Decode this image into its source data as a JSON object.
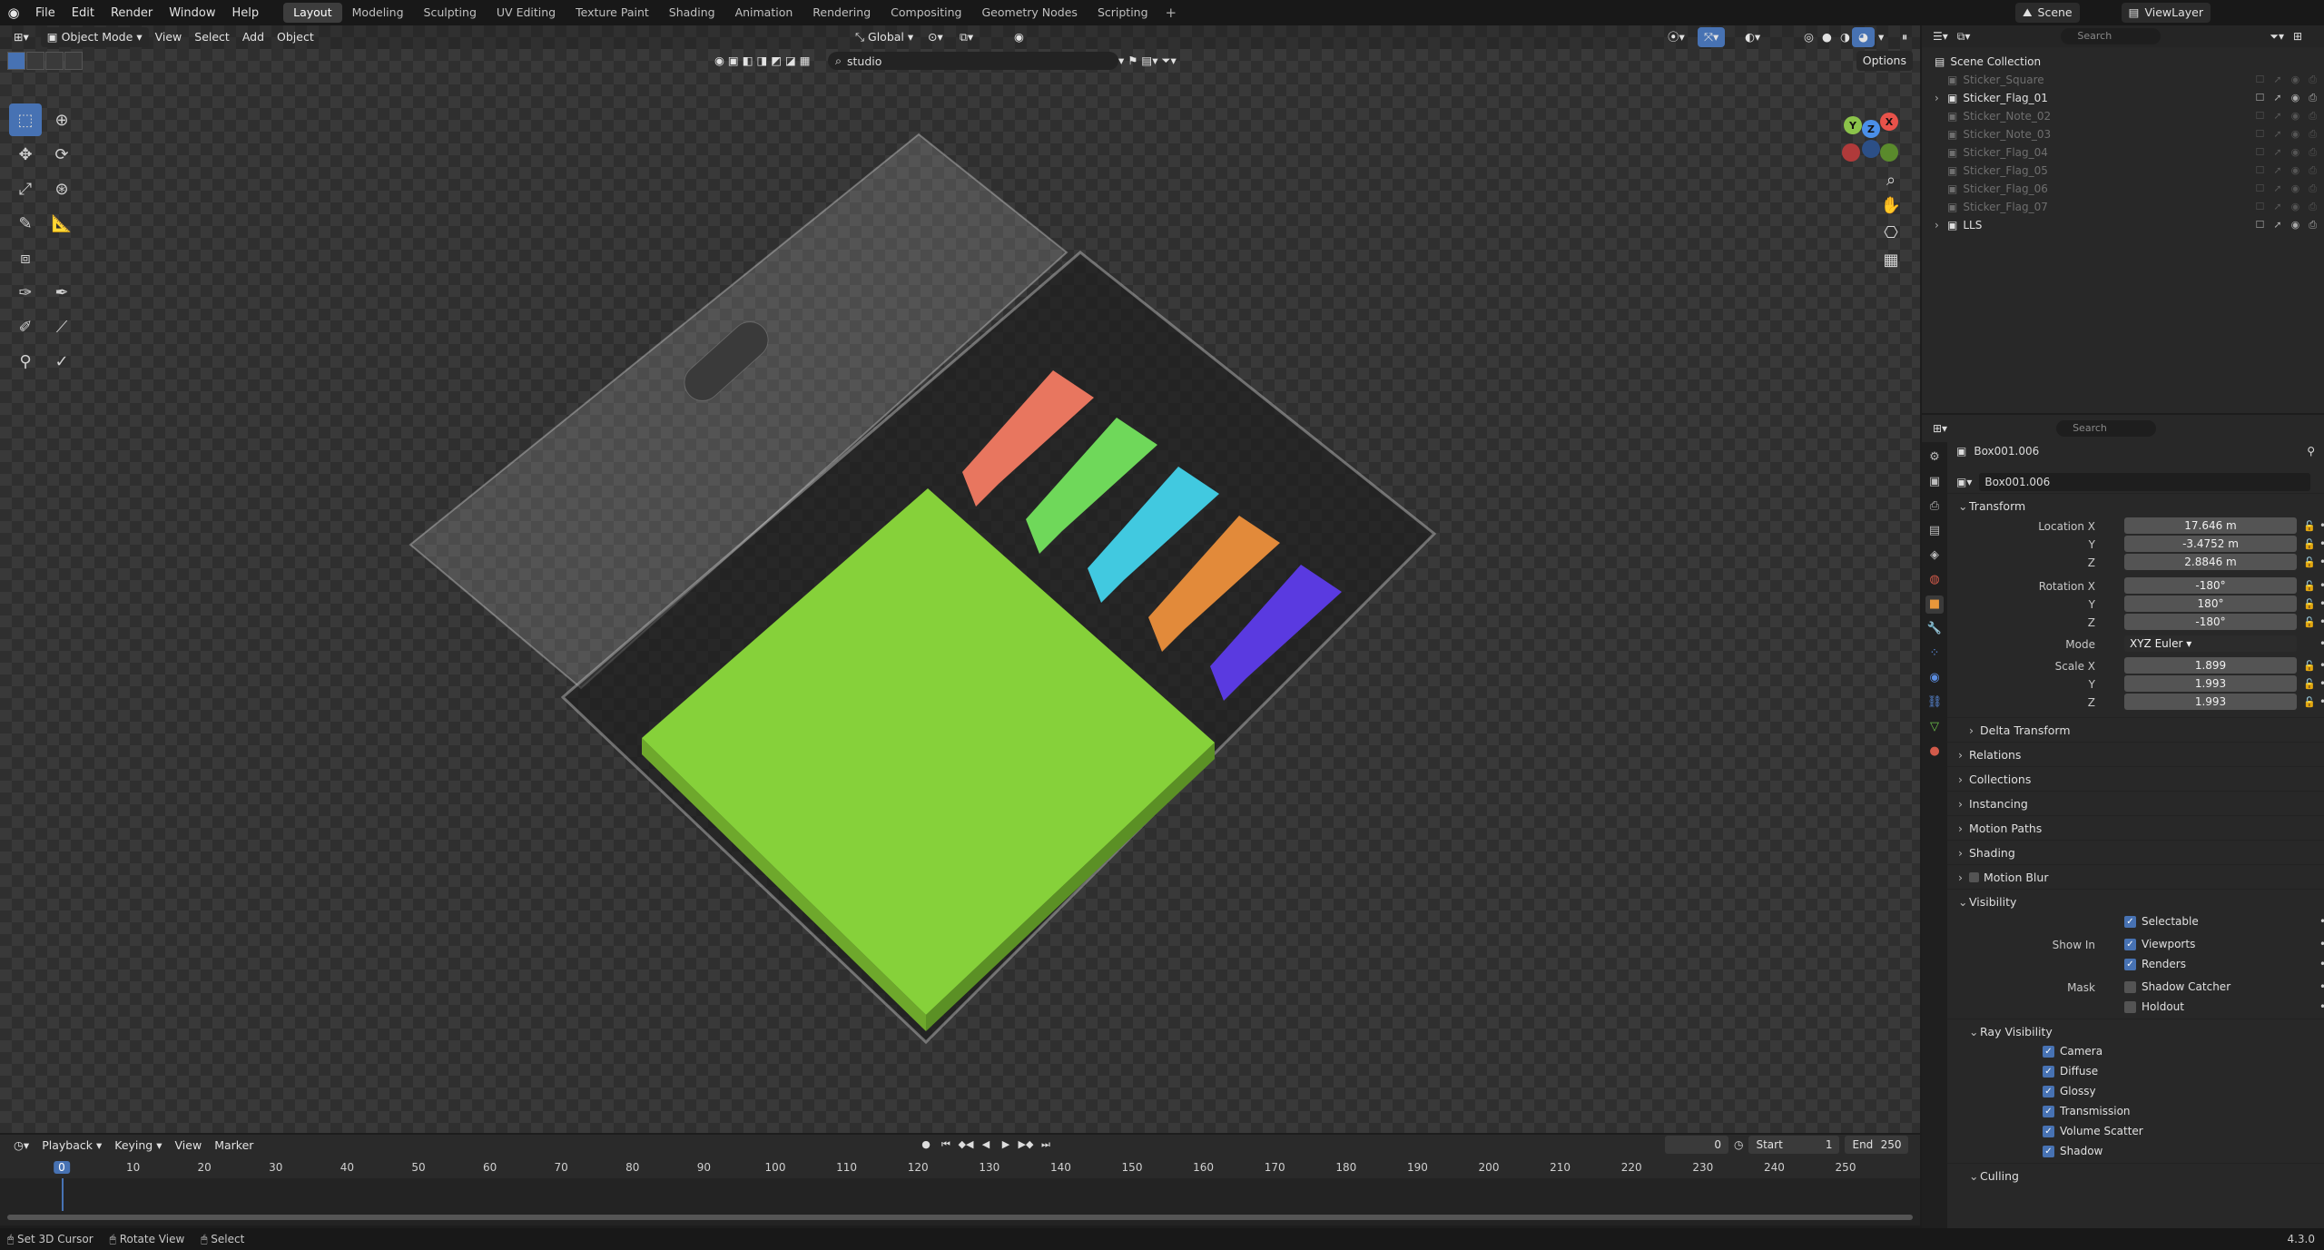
{
  "menu": [
    "File",
    "Edit",
    "Render",
    "Window",
    "Help"
  ],
  "workspaces": [
    "Layout",
    "Modeling",
    "Sculpting",
    "UV Editing",
    "Texture Paint",
    "Shading",
    "Animation",
    "Rendering",
    "Compositing",
    "Geometry Nodes",
    "Scripting"
  ],
  "active_workspace": "Layout",
  "scene": {
    "name": "Scene",
    "view_layer": "ViewLayer"
  },
  "viewport": {
    "mode": "Object Mode",
    "menu": [
      "View",
      "Select",
      "Add",
      "Object"
    ],
    "orientation": "Global",
    "search_value": "studio",
    "options_label": "Options",
    "sticker_colors": [
      "#e8765f",
      "#6fd85a",
      "#41c9e0",
      "#e28a3a",
      "#5a3ae0"
    ],
    "note_color": "#86d13a"
  },
  "outliner": {
    "search_placeholder": "Search",
    "collection": "Scene Collection",
    "items": [
      {
        "name": "Sticker_Square",
        "dim": true
      },
      {
        "name": "Sticker_Flag_01",
        "dim": false
      },
      {
        "name": "Sticker_Note_02",
        "dim": true
      },
      {
        "name": "Sticker_Note_03",
        "dim": true
      },
      {
        "name": "Sticker_Flag_04",
        "dim": true
      },
      {
        "name": "Sticker_Flag_05",
        "dim": true
      },
      {
        "name": "Sticker_Flag_06",
        "dim": true
      },
      {
        "name": "Sticker_Flag_07",
        "dim": true
      },
      {
        "name": "LLS",
        "dim": false
      }
    ]
  },
  "properties": {
    "search_placeholder": "Search",
    "object_name": "Box001.006",
    "object_field": "Box001.006",
    "transform_title": "Transform",
    "location_label": "Location X",
    "location": [
      "17.646 m",
      "-3.4752 m",
      "2.8846 m"
    ],
    "rotation_label": "Rotation X",
    "rotation": [
      "-180°",
      "180°",
      "-180°"
    ],
    "mode_label": "Mode",
    "mode_value": "XYZ Euler",
    "scale_label": "Scale X",
    "scale": [
      "1.899",
      "1.993",
      "1.993"
    ],
    "axis_y": "Y",
    "axis_z": "Z",
    "sections": [
      "Delta Transform",
      "Relations",
      "Collections",
      "Instancing",
      "Motion Paths",
      "Shading",
      "Motion Blur"
    ],
    "visibility_title": "Visibility",
    "selectable": "Selectable",
    "show_in": "Show In",
    "viewports": "Viewports",
    "renders": "Renders",
    "mask": "Mask",
    "shadow_catcher": "Shadow Catcher",
    "holdout": "Holdout",
    "ray_visibility": "Ray Visibility",
    "ray_items": [
      "Camera",
      "Diffuse",
      "Glossy",
      "Transmission",
      "Volume Scatter",
      "Shadow"
    ],
    "culling": "Culling"
  },
  "timeline": {
    "menu": [
      "Playback",
      "Keying",
      "View",
      "Marker"
    ],
    "current_frame": "0",
    "start_label": "Start",
    "start": "1",
    "end_label": "End",
    "end": "250",
    "ticks": [
      "0",
      "10",
      "20",
      "30",
      "40",
      "50",
      "60",
      "70",
      "80",
      "90",
      "100",
      "110",
      "120",
      "130",
      "140",
      "150",
      "160",
      "170",
      "180",
      "190",
      "200",
      "210",
      "220",
      "230",
      "240",
      "250"
    ]
  },
  "status": {
    "items": [
      "Set 3D Cursor",
      "Rotate View",
      "Select"
    ],
    "version": "4.3.0"
  }
}
